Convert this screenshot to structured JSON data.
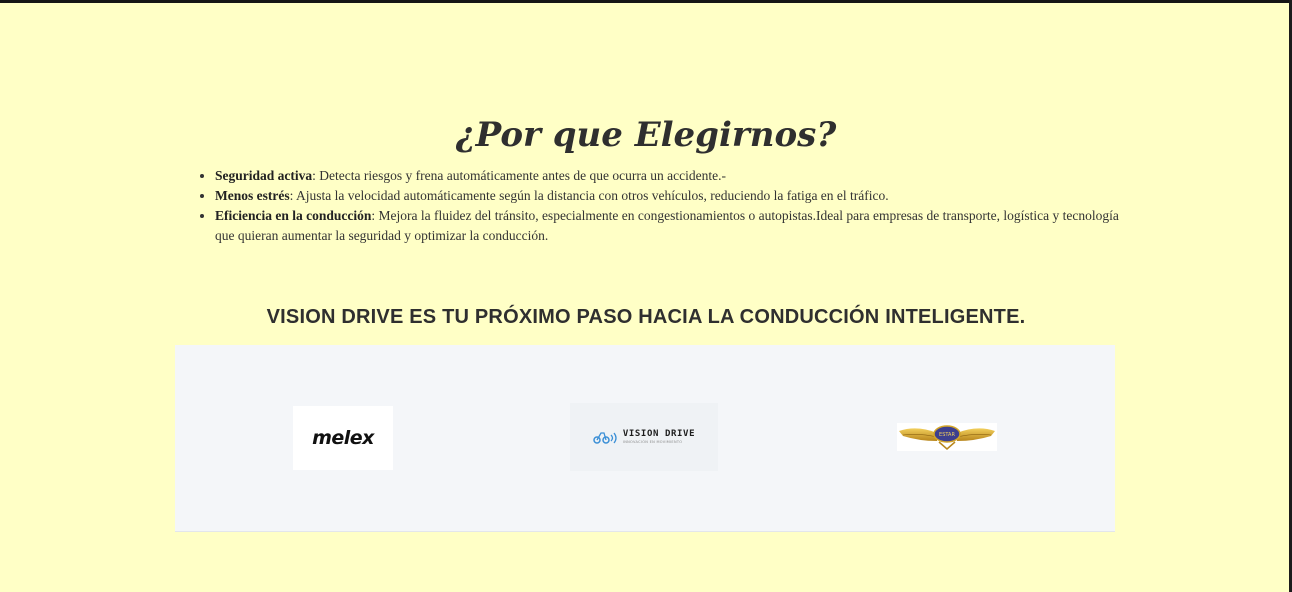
{
  "section": {
    "title": "¿Por que Elegirnos?",
    "features": [
      {
        "term": "Seguridad activa",
        "text": ": Detecta riesgos y frena automáticamente antes de que ocurra un accidente.-"
      },
      {
        "term": "Menos estrés",
        "text": ": Ajusta la velocidad automáticamente según la distancia con otros vehículos, reduciendo la fatiga en el tráfico."
      },
      {
        "term": "Eficiencia en la conducción",
        "text": ": Mejora la fluidez del tránsito, especialmente en congestionamientos o autopistas.Ideal para empresas de transporte, logística y tecnología que quieran aumentar la seguridad y optimizar la conducción."
      }
    ],
    "tagline": "VISION DRIVE ES TU PRÓXIMO PASO HACIA LA CONDUCCIÓN INTELIGENTE."
  },
  "logos": {
    "melex": "melex",
    "vision_drive": "VISION DRIVE",
    "vision_drive_sub": "INNOVACIÓN EN MOVIMIENTO",
    "wings_badge": "ESTAR"
  },
  "colors": {
    "background": "#ffffc6",
    "strip": "#f4f6f9",
    "text": "#2d2d2d",
    "vision_icon": "#3a8fd6",
    "wings_gold": "#d4a629",
    "badge_blue": "#3d3f8f"
  },
  "icons": {
    "vision_logo_mark": "car-signal-icon",
    "wings_logo_mark": "winged-badge-icon"
  }
}
